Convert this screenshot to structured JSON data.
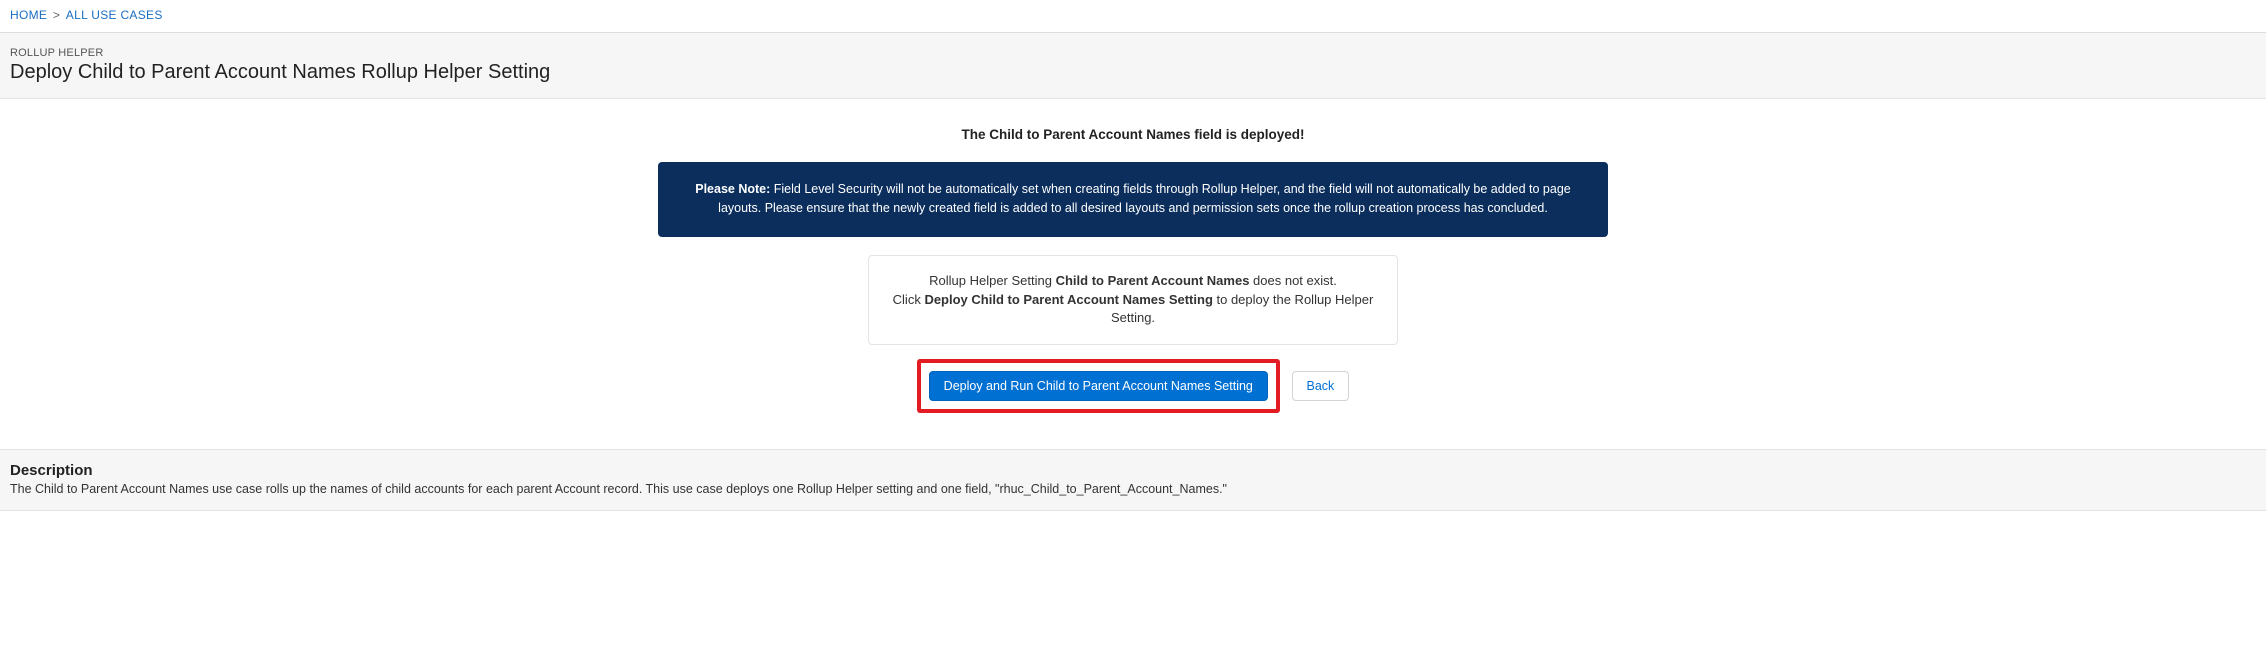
{
  "breadcrumb": {
    "home": "HOME",
    "sep": ">",
    "all_use_cases": "ALL USE CASES"
  },
  "header": {
    "eyebrow": "ROLLUP HELPER",
    "title": "Deploy Child to Parent Account Names Rollup Helper Setting"
  },
  "deployed_msg": "The Child to Parent Account Names field is deployed!",
  "note": {
    "prefix": "Please Note:",
    "body": " Field Level Security will not be automatically set when creating fields through Rollup Helper, and the field will not automatically be added to page layouts. Please ensure that the newly created field is added to all desired layouts and permission sets once the rollup creation process has concluded."
  },
  "info_card": {
    "line1_pre": "Rollup Helper Setting ",
    "line1_bold": "Child to Parent Account Names",
    "line1_post": " does not exist.",
    "line2_pre": "Click ",
    "line2_bold": "Deploy Child to Parent Account Names Setting",
    "line2_post": " to deploy the Rollup Helper Setting."
  },
  "buttons": {
    "deploy": "Deploy and Run Child to Parent Account Names Setting",
    "back": "Back"
  },
  "description": {
    "heading": "Description",
    "body": "The Child to Parent Account Names use case rolls up the names of child accounts for each parent Account record. This use case deploys one Rollup Helper setting and one field, \"rhuc_Child_to_Parent_Account_Names.\""
  }
}
